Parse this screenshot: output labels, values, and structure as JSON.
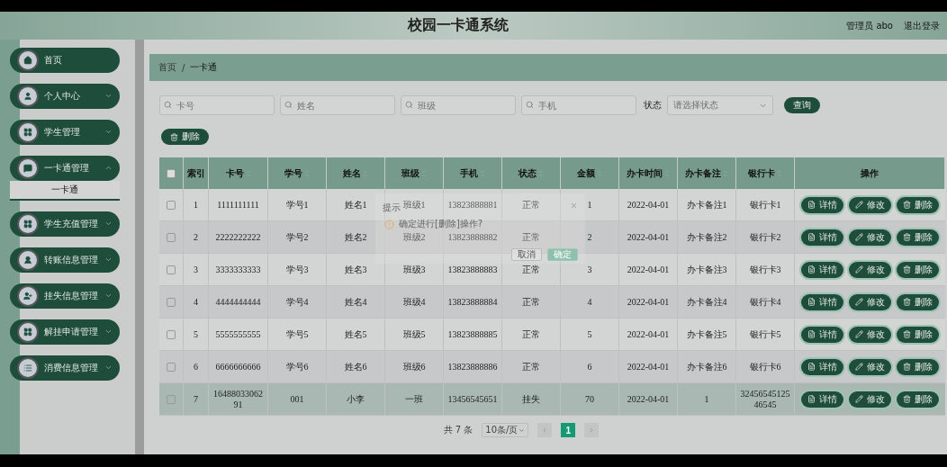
{
  "header": {
    "title": "校园一卡通系统",
    "user": "管理员 abo",
    "logout": "退出登录"
  },
  "sidebar": {
    "items": [
      {
        "label": "首页",
        "expandable": false
      },
      {
        "label": "个人中心",
        "expandable": true,
        "expanded": false
      },
      {
        "label": "学生管理",
        "expandable": true,
        "expanded": false
      },
      {
        "label": "一卡通管理",
        "expandable": true,
        "expanded": true,
        "children": [
          {
            "label": "一卡通",
            "selected": true
          }
        ]
      },
      {
        "label": "学生充值管理",
        "expandable": true,
        "expanded": false
      },
      {
        "label": "转账信息管理",
        "expandable": true,
        "expanded": false
      },
      {
        "label": "挂失信息管理",
        "expandable": true,
        "expanded": false
      },
      {
        "label": "解挂申请管理",
        "expandable": true,
        "expanded": false
      },
      {
        "label": "消费信息管理",
        "expandable": true,
        "expanded": false
      }
    ]
  },
  "breadcrumb": {
    "items": [
      "首页",
      "一卡通"
    ],
    "separator": "/"
  },
  "search": {
    "fields": [
      {
        "placeholder": "卡号"
      },
      {
        "placeholder": "姓名"
      },
      {
        "placeholder": "班级"
      },
      {
        "placeholder": "手机"
      }
    ],
    "status_label": "状态",
    "status_placeholder": "请选择状态",
    "button": "查询"
  },
  "delete_button": "删除",
  "table": {
    "header_checked": false,
    "columns": [
      {
        "label": "索引",
        "sortable": false
      },
      {
        "label": "卡号",
        "sortable": true
      },
      {
        "label": "学号",
        "sortable": true
      },
      {
        "label": "姓名",
        "sortable": true
      },
      {
        "label": "班级",
        "sortable": true
      },
      {
        "label": "手机",
        "sortable": true
      },
      {
        "label": "状态",
        "sortable": true
      },
      {
        "label": "金额",
        "sortable": true
      },
      {
        "label": "办卡时间",
        "sortable": true
      },
      {
        "label": "办卡备注",
        "sortable": true
      },
      {
        "label": "银行卡",
        "sortable": true
      },
      {
        "label": "操作",
        "sortable": false
      }
    ],
    "rows": [
      {
        "checked": false,
        "highlighted": false,
        "cells": [
          "1",
          "1111111111",
          "学号1",
          "姓名1",
          "班级1",
          "13823888881",
          "正常",
          "1",
          "2022-04-01",
          "办卡备注1",
          "银行卡1"
        ],
        "actions": [
          "详情",
          "修改",
          "删除"
        ]
      },
      {
        "checked": false,
        "highlighted": false,
        "cells": [
          "2",
          "2222222222",
          "学号2",
          "姓名2",
          "班级2",
          "13823888882",
          "正常",
          "2",
          "2022-04-01",
          "办卡备注2",
          "银行卡2"
        ],
        "actions": [
          "详情",
          "修改",
          "删除"
        ]
      },
      {
        "checked": false,
        "highlighted": false,
        "cells": [
          "3",
          "3333333333",
          "学号3",
          "姓名3",
          "班级3",
          "13823888883",
          "正常",
          "3",
          "2022-04-01",
          "办卡备注3",
          "银行卡3"
        ],
        "actions": [
          "详情",
          "修改",
          "删除"
        ]
      },
      {
        "checked": false,
        "highlighted": false,
        "cells": [
          "4",
          "4444444444",
          "学号4",
          "姓名4",
          "班级4",
          "13823888884",
          "正常",
          "4",
          "2022-04-01",
          "办卡备注4",
          "银行卡4"
        ],
        "actions": [
          "详情",
          "修改",
          "删除"
        ]
      },
      {
        "checked": false,
        "highlighted": false,
        "cells": [
          "5",
          "5555555555",
          "学号5",
          "姓名5",
          "班级5",
          "13823888885",
          "正常",
          "5",
          "2022-04-01",
          "办卡备注5",
          "银行卡5"
        ],
        "actions": [
          "详情",
          "修改",
          "删除"
        ]
      },
      {
        "checked": false,
        "highlighted": false,
        "cells": [
          "6",
          "6666666666",
          "学号6",
          "姓名6",
          "班级6",
          "13823888886",
          "正常",
          "6",
          "2022-04-01",
          "办卡备注6",
          "银行卡6"
        ],
        "actions": [
          "详情",
          "修改",
          "删除"
        ]
      },
      {
        "checked": false,
        "highlighted": true,
        "cells": [
          "7",
          "1648803306291",
          "001",
          "小李",
          "一班",
          "13456545651",
          "挂失",
          "70",
          "2022-04-01",
          "1",
          "3245654512546545"
        ],
        "actions": [
          "详情",
          "修改",
          "删除"
        ]
      }
    ]
  },
  "pagination": {
    "total": "共 7 条",
    "page_size": "10条/页",
    "pages": [
      {
        "label": "1",
        "selected": true
      }
    ]
  },
  "dialog": {
    "title": "提示",
    "message": "确定进行[删除]操作?",
    "buttons": [
      "取消",
      "确定"
    ]
  }
}
